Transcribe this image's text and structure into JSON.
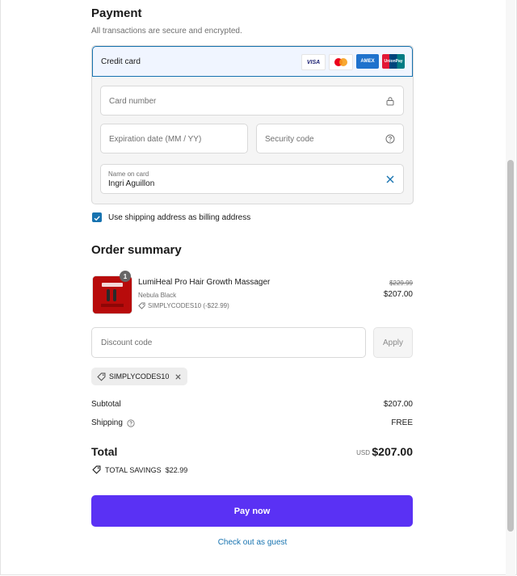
{
  "payment": {
    "title": "Payment",
    "subtitle": "All transactions are secure and encrypted.",
    "method_label": "Credit card",
    "card_logos": [
      "VISA",
      "mastercard",
      "AMEX",
      "UnionPay"
    ],
    "card_number_placeholder": "Card number",
    "expiration_placeholder": "Expiration date (MM / YY)",
    "security_placeholder": "Security code",
    "name_label": "Name on card",
    "name_value": "Ingri Aguillon",
    "billing_checkbox_label": "Use shipping address as billing address",
    "billing_checked": true
  },
  "order_summary": {
    "title": "Order summary",
    "item": {
      "quantity": "1",
      "name": "LumiHeal Pro Hair Growth Massager",
      "variant": "Nebula Black",
      "discount": "SIMPLYCODES10 (-$22.99)",
      "original_price": "$229.99",
      "price": "$207.00"
    },
    "discount_placeholder": "Discount code",
    "apply_label": "Apply",
    "applied_code": "SIMPLYCODES10",
    "subtotal_label": "Subtotal",
    "subtotal_value": "$207.00",
    "shipping_label": "Shipping",
    "shipping_value": "FREE",
    "total_label": "Total",
    "currency": "USD",
    "total_value": "$207.00",
    "savings_label": "TOTAL SAVINGS",
    "savings_value": "$22.99"
  },
  "actions": {
    "pay_label": "Pay now",
    "guest_label": "Check out as guest"
  },
  "colors": {
    "accent": "#1773b0",
    "pay_button": "#5a31f4"
  }
}
